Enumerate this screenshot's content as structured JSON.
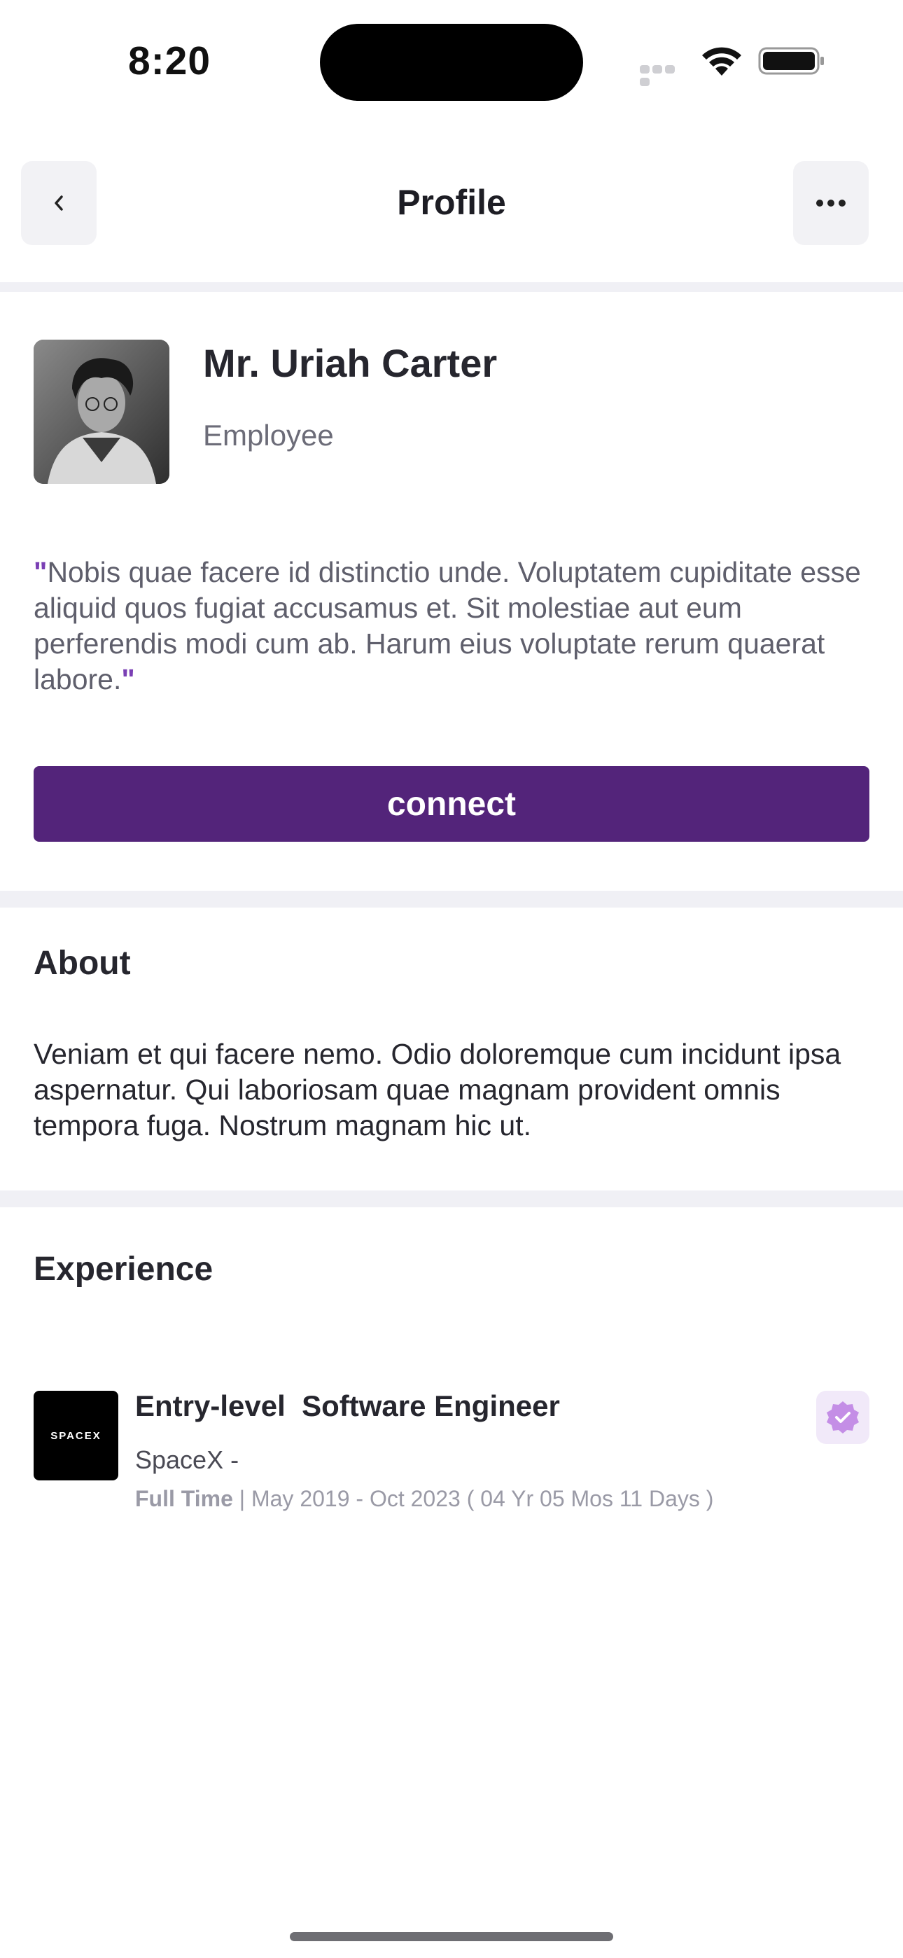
{
  "status_bar": {
    "time": "8:20"
  },
  "nav": {
    "title": "Profile",
    "back_icon": "chevron-left-icon",
    "more_icon": "ellipsis-icon"
  },
  "profile": {
    "name": "Mr. Uriah Carter",
    "role": "Employee",
    "quote_open": "\"",
    "quote": "Nobis quae facere id distinctio unde. Voluptatem cupiditate esse aliquid quos fugiat accusamus et. Sit molestiae aut eum perferendis modi cum ab. Harum eius voluptate rerum quaerat labore.",
    "quote_close": "\"",
    "connect_label": "connect"
  },
  "about": {
    "title": "About",
    "text": "Veniam et qui facere nemo. Odio doloremque cum incidunt ipsa aspernatur. Qui laboriosam quae magnam provident omnis tempora fuga. Nostrum magnam hic ut."
  },
  "experience": {
    "title": "Experience",
    "items": [
      {
        "job_title": "Entry-level  Software Engineer",
        "company": "SpaceX -",
        "logo_text": "SPACEX",
        "employment_type": "Full Time",
        "separator": " | ",
        "duration": "May 2019 - Oct 2023 ( 04 Yr 05 Mos 11 Days )",
        "badge_icon": "verified-badge-icon"
      }
    ]
  },
  "colors": {
    "accent": "#53247a",
    "quote_mark": "#7a3fb4",
    "divider": "#f0f0f5",
    "badge_bg": "#f1e9f9",
    "badge_fg": "#c48ee6"
  }
}
